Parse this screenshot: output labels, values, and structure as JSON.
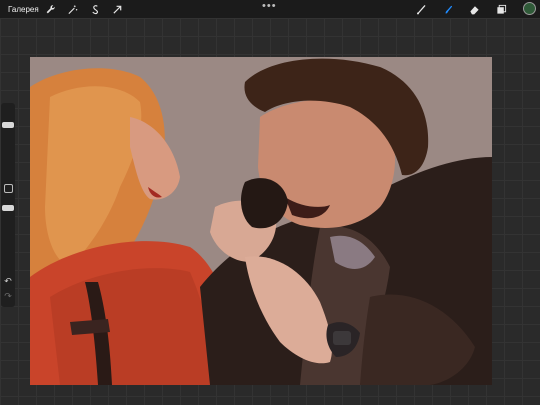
{
  "app": {
    "gallery_label": "Галерея"
  },
  "toolbar": {
    "actions": [
      "wrench-icon",
      "magic-wand-icon",
      "selection-icon",
      "transform-arrow-icon"
    ],
    "more_label": "•••",
    "brush_tools": [
      "brush-icon",
      "smudge-icon",
      "eraser-icon",
      "layers-icon"
    ],
    "active_tool": "smudge-icon",
    "active_color": "#2f5a38",
    "accent_color": "#1f8bff"
  },
  "sidebar": {
    "brush_size_level": 0.15,
    "opacity_level": 0.5,
    "undo_label": "↶",
    "redo_label": "↷"
  },
  "canvas": {
    "background_color": "#9b8984"
  }
}
